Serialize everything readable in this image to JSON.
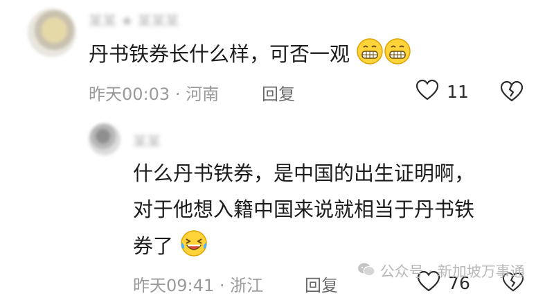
{
  "comment1": {
    "author_blurred": "某某 ★ 某某某",
    "text": "丹书铁券长什么样，可否一观",
    "time": "昨天00:03",
    "separator": "·",
    "location": "河南",
    "reply_label": "回复",
    "like_count": "11"
  },
  "comment2": {
    "author_blurred": "某某",
    "text_line1": "什么丹书铁券，是中国的出生证明啊，",
    "text_line2": "对于他想入籍中国来说就相当于丹书铁",
    "text_line3": "券了",
    "time": "昨天09:41",
    "separator": "·",
    "location": "浙江",
    "reply_label": "回复",
    "like_count": "76"
  },
  "watermark": {
    "text": "公众号 · 新加坡万事通"
  },
  "colors": {
    "emoji_yellow": "#ffd43b",
    "emoji_outline": "#e0a100",
    "meta_gray": "#9a9a9a"
  },
  "icons": {
    "grin": "grinning-emoji-icon",
    "laugh_cry": "laughing-crying-emoji-icon",
    "heart": "heart-outline-icon",
    "dislike": "broken-heart-icon",
    "wechat": "wechat-icon"
  }
}
